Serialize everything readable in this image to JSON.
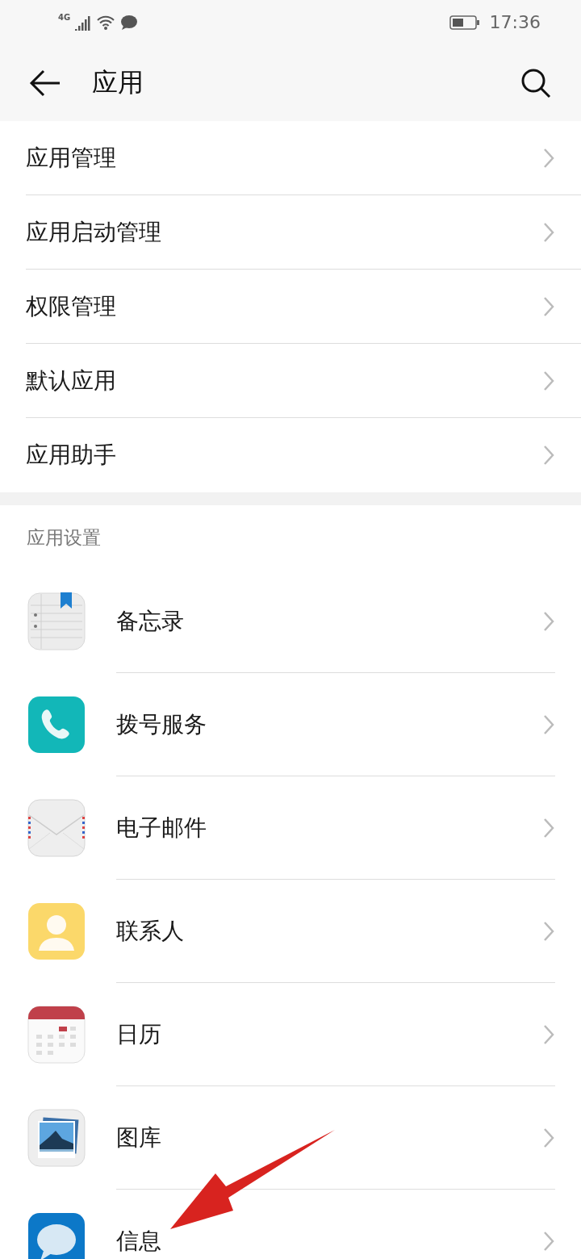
{
  "status_bar": {
    "network": "4G",
    "time": "17:36"
  },
  "header": {
    "title": "应用"
  },
  "menu": [
    {
      "label": "应用管理"
    },
    {
      "label": "应用启动管理"
    },
    {
      "label": "权限管理"
    },
    {
      "label": "默认应用"
    },
    {
      "label": "应用助手"
    }
  ],
  "app_settings": {
    "title": "应用设置",
    "apps": [
      {
        "label": "备忘录",
        "kind": "notes"
      },
      {
        "label": "拨号服务",
        "kind": "phone"
      },
      {
        "label": "电子邮件",
        "kind": "mail"
      },
      {
        "label": "联系人",
        "kind": "contact"
      },
      {
        "label": "日历",
        "kind": "calendar"
      },
      {
        "label": "图库",
        "kind": "gallery"
      },
      {
        "label": "信息",
        "kind": "message"
      }
    ]
  }
}
